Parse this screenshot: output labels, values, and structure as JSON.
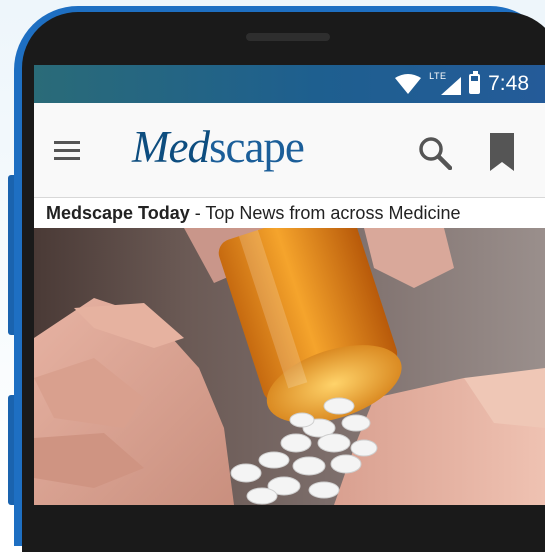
{
  "status_bar": {
    "network_label": "LTE",
    "time": "7:48",
    "icons": [
      "wifi-icon",
      "signal-icon",
      "battery-icon"
    ]
  },
  "app_bar": {
    "logo_part1": "Med",
    "logo_part2": "scape",
    "icons": [
      "menu-icon",
      "search-icon",
      "bookmark-icon"
    ]
  },
  "subtitle": {
    "bold": "Medscape Today",
    "rest": " - Top News from across Medicine"
  },
  "colors": {
    "phone_body": "#1e6fc2",
    "status_bar": "#245b99",
    "logo": "#0d4d7f"
  },
  "hero": {
    "image_description_icon": "pills-in-hand-photo"
  }
}
